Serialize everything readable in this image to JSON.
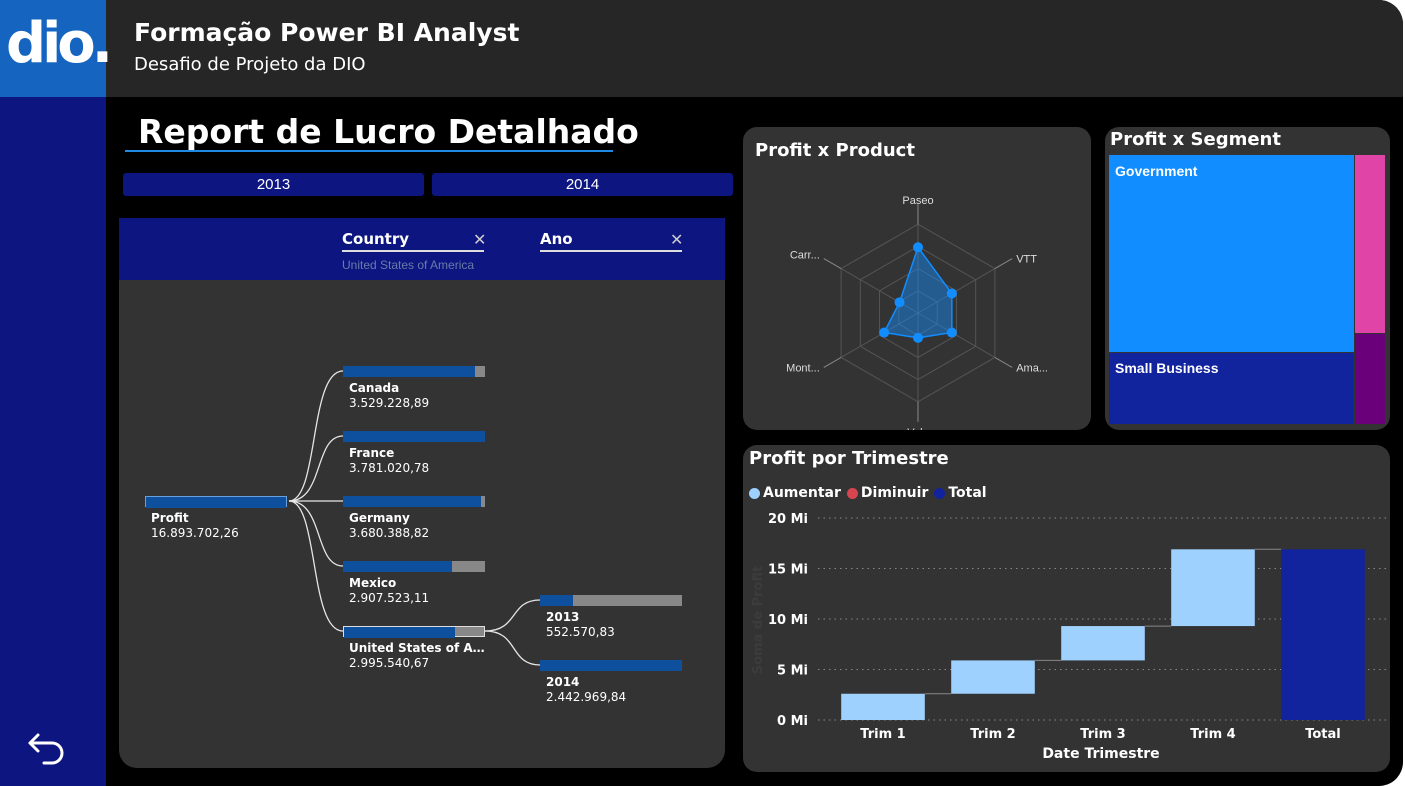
{
  "header": {
    "logo_text": "dio.",
    "title": "Formação Power BI Analyst",
    "subtitle": "Desafio de Projeto da DIO"
  },
  "report": {
    "title": "Report de Lucro Detalhado",
    "year_buttons": [
      "2013",
      "2014"
    ]
  },
  "decomposition_tree": {
    "levels": [
      {
        "label": "Country",
        "selection": "United States of America"
      },
      {
        "label": "Ano",
        "selection": ""
      }
    ],
    "root": {
      "name": "Profit",
      "value": "16.893.702,26",
      "fill": 1.0
    },
    "countries": [
      {
        "name": "Canada",
        "value": "3.529.228,89",
        "fill": 0.93
      },
      {
        "name": "France",
        "value": "3.781.020,78",
        "fill": 1.0
      },
      {
        "name": "Germany",
        "value": "3.680.388,82",
        "fill": 0.97
      },
      {
        "name": "Mexico",
        "value": "2.907.523,11",
        "fill": 0.77
      },
      {
        "name": "United States of America",
        "value": "2.995.540,67",
        "fill": 0.79
      }
    ],
    "years": [
      {
        "name": "2013",
        "value": "552.570,83",
        "fill": 0.23
      },
      {
        "name": "2014",
        "value": "2.442.969,84",
        "fill": 1.0
      }
    ]
  },
  "radar": {
    "title": "Profit x Product",
    "axes": [
      "Paseo",
      "VTT",
      "Ama...",
      "Velo",
      "Mont...",
      "Carr..."
    ],
    "relative_values": [
      0.74,
      0.44,
      0.44,
      0.28,
      0.44,
      0.24
    ],
    "color": "#118dff"
  },
  "segment": {
    "title": "Profit x Segment",
    "tiles": [
      {
        "label": "Government",
        "color": "#118dff"
      },
      {
        "label": "Small Business",
        "color": "#12239e"
      },
      {
        "label": "",
        "color": "#e044a7"
      },
      {
        "label": "",
        "color": "#6b007b"
      }
    ]
  },
  "chart_data": {
    "type": "bar",
    "title": "Profit por Trimestre",
    "subtype": "waterfall",
    "categories": [
      "Trim 1",
      "Trim 2",
      "Trim 3",
      "Trim 4",
      "Total"
    ],
    "series": [
      {
        "name": "Aumentar",
        "values": [
          2.6,
          3.3,
          3.4,
          7.6,
          null
        ]
      },
      {
        "name": "Total",
        "values": [
          null,
          null,
          null,
          null,
          16.9
        ]
      }
    ],
    "legend": [
      "Aumentar",
      "Diminuir",
      "Total"
    ],
    "legend_colors": [
      "#9fd1ff",
      "#d64550",
      "#12239e"
    ],
    "xlabel": "Date Trimestre",
    "ylabel": "Soma de Profit",
    "ylim": [
      0,
      20
    ],
    "yticks": [
      "0 Mi",
      "5 Mi",
      "10 Mi",
      "15 Mi",
      "20 Mi"
    ],
    "grid": true,
    "legend_position": "top-left"
  }
}
